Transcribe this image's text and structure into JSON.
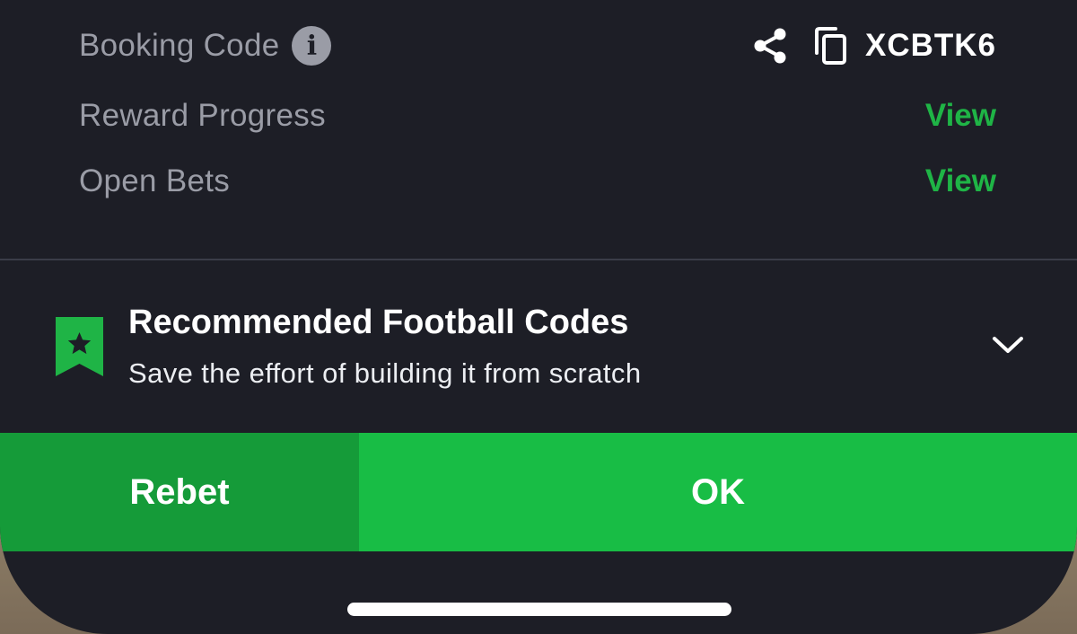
{
  "rows": {
    "booking": {
      "label": "Booking Code",
      "info_icon": "info-icon",
      "share_icon": "share-icon",
      "copy_icon": "copy-icon",
      "code": "XCBTK6"
    },
    "reward": {
      "label": "Reward Progress",
      "action": "View"
    },
    "open_bets": {
      "label": "Open Bets",
      "action": "View"
    }
  },
  "recommended": {
    "icon": "bookmark-star-icon",
    "title": "Recommended Football Codes",
    "subtitle": "Save the effort of building it from scratch",
    "toggle_icon": "chevron-down-icon"
  },
  "buttons": {
    "rebet": "Rebet",
    "ok": "OK"
  },
  "colors": {
    "background": "#1d1e26",
    "accent_green": "#1fb446",
    "rebet_green": "#159b39",
    "ok_green": "#18bd45",
    "muted_text": "#9a9ca6"
  }
}
